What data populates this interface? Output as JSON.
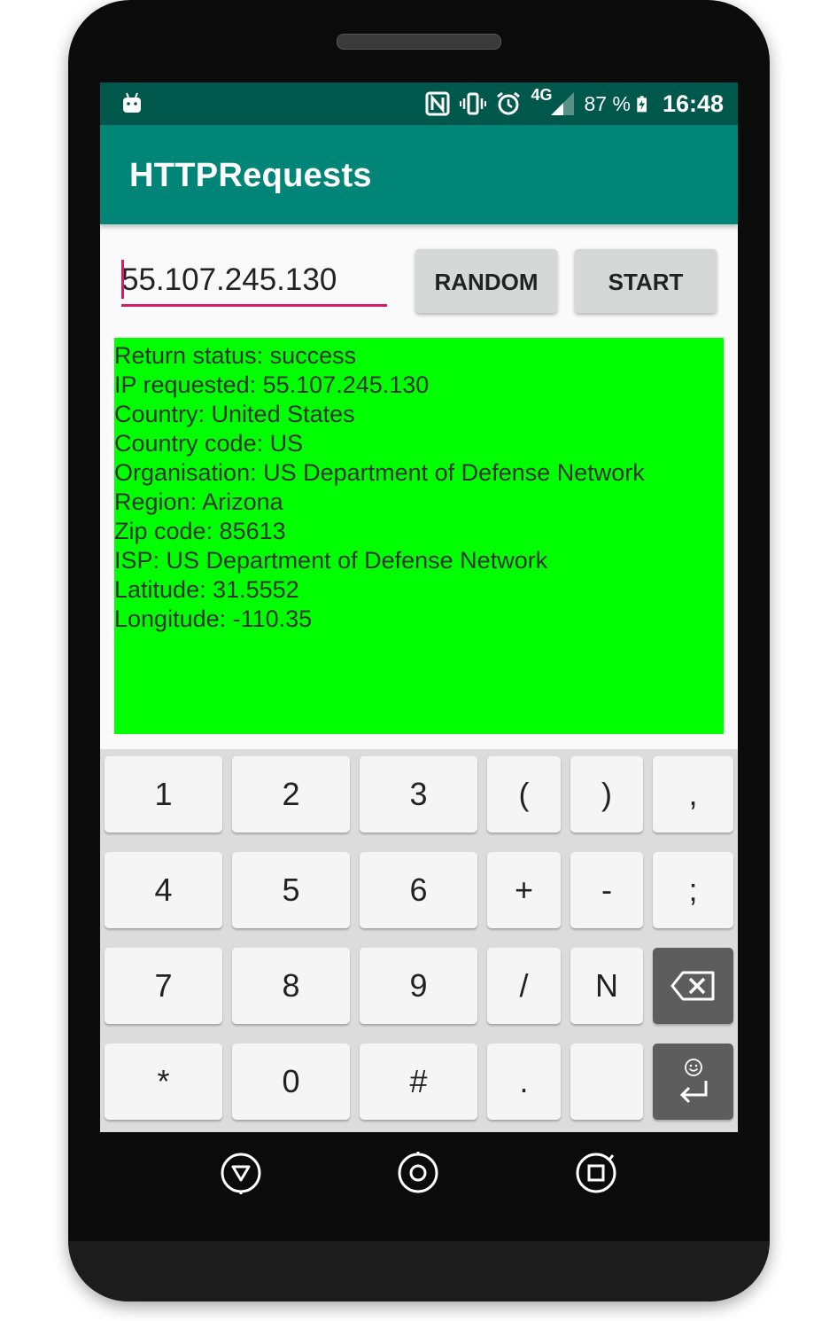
{
  "status_bar": {
    "network": "4G",
    "battery_percent": "87 %",
    "clock": "16:48",
    "icons": [
      "android-debug-icon",
      "nfc-icon",
      "vibrate-icon",
      "alarm-icon",
      "signal-icon",
      "battery-charging-icon"
    ]
  },
  "app_bar": {
    "title": "HTTPRequests"
  },
  "form": {
    "ip_value": "55.107.245.130",
    "random_label": "RANDOM",
    "start_label": "START"
  },
  "result": {
    "background": "#00ff00",
    "lines": [
      "Return status: success",
      "IP requested: 55.107.245.130",
      "Country: United States",
      "Country code: US",
      "Organisation: US Department of Defense Network",
      "Region: Arizona",
      "Zip code: 85613",
      "ISP: US Department of Defense Network",
      "Latitude: 31.5552",
      "Longitude: -110.35"
    ]
  },
  "keyboard": {
    "rows": [
      [
        "1",
        "2",
        "3",
        "(",
        ")",
        ","
      ],
      [
        "4",
        "5",
        "6",
        "+",
        "-",
        ";"
      ],
      [
        "7",
        "8",
        "9",
        "/",
        "N",
        "backspace"
      ],
      [
        "*",
        "0",
        "#",
        ".",
        "",
        "enter"
      ]
    ]
  },
  "nav_bar": {
    "buttons": [
      "back-icon",
      "home-icon",
      "recents-icon"
    ]
  },
  "colors": {
    "primary": "#008577",
    "primary_dark": "#00574b",
    "accent": "#d81b60"
  }
}
